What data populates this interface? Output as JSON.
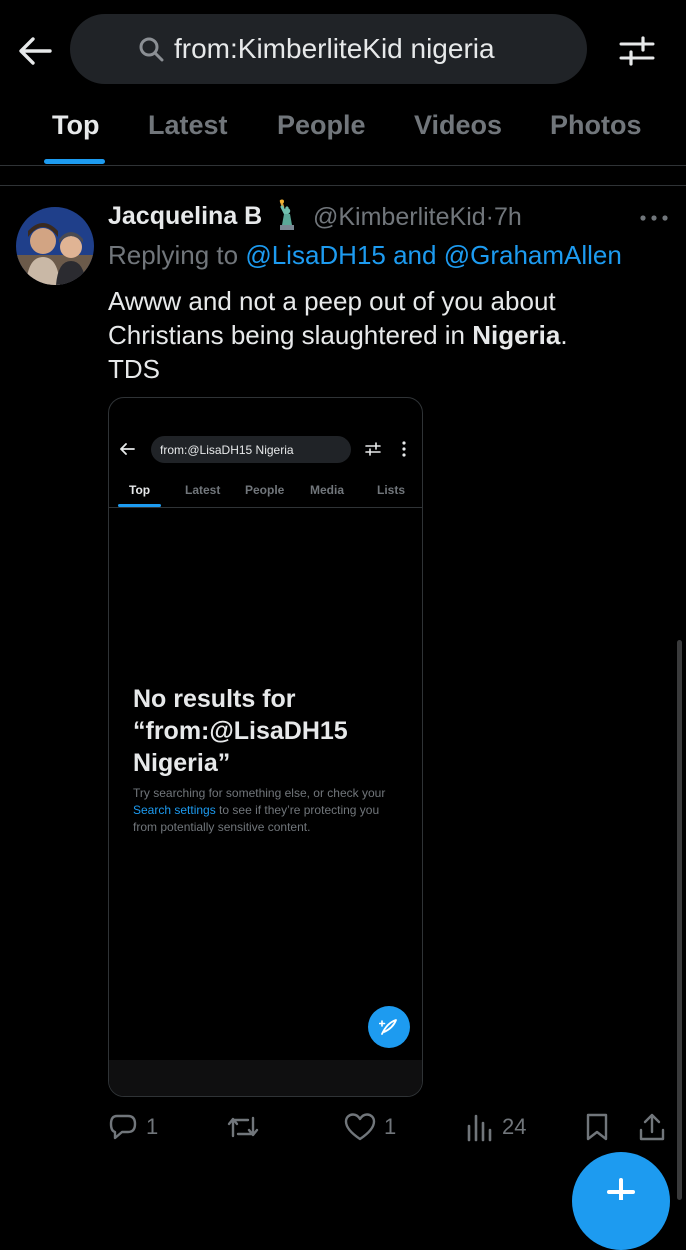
{
  "header": {
    "search_query": "from:KimberliteKid nigeria"
  },
  "tabs": [
    {
      "label": "Top",
      "active": true
    },
    {
      "label": "Latest",
      "active": false
    },
    {
      "label": "People",
      "active": false
    },
    {
      "label": "Videos",
      "active": false
    },
    {
      "label": "Photos",
      "active": false
    }
  ],
  "tweet": {
    "author_name": "Jacquelina B",
    "name_emoji_icon": "statue-of-liberty",
    "handle": "@KimberliteKid",
    "separator": "·",
    "time": "7h",
    "replying_prefix": "Replying to",
    "replying_to": "@LisaDH15 and @GrahamAllen",
    "text_before": "Awww and not a peep out of you about Christians being slaughtered in ",
    "text_bold": "Nigeria",
    "text_after": ".",
    "text_line3": "TDS",
    "actions": {
      "replies": "1",
      "retweets": "",
      "likes": "1",
      "views": "24"
    }
  },
  "embedded_screenshot": {
    "search_query": "from:@LisaDH15 Nigeria",
    "tabs": [
      "Top",
      "Latest",
      "People",
      "Media",
      "Lists"
    ],
    "active_tab": "Top",
    "heading": "No results for “from:@LisaDH15 Nigeria”",
    "body_before": "Try searching for something else, or check your ",
    "body_link": "Search settings",
    "body_after": " to see if they’re protecting you from potentially sensitive content."
  },
  "colors": {
    "background": "#000000",
    "accent": "#1d9bf0",
    "text_primary": "#e7e9ea",
    "text_secondary": "#71767b",
    "search_pill": "#202327"
  }
}
